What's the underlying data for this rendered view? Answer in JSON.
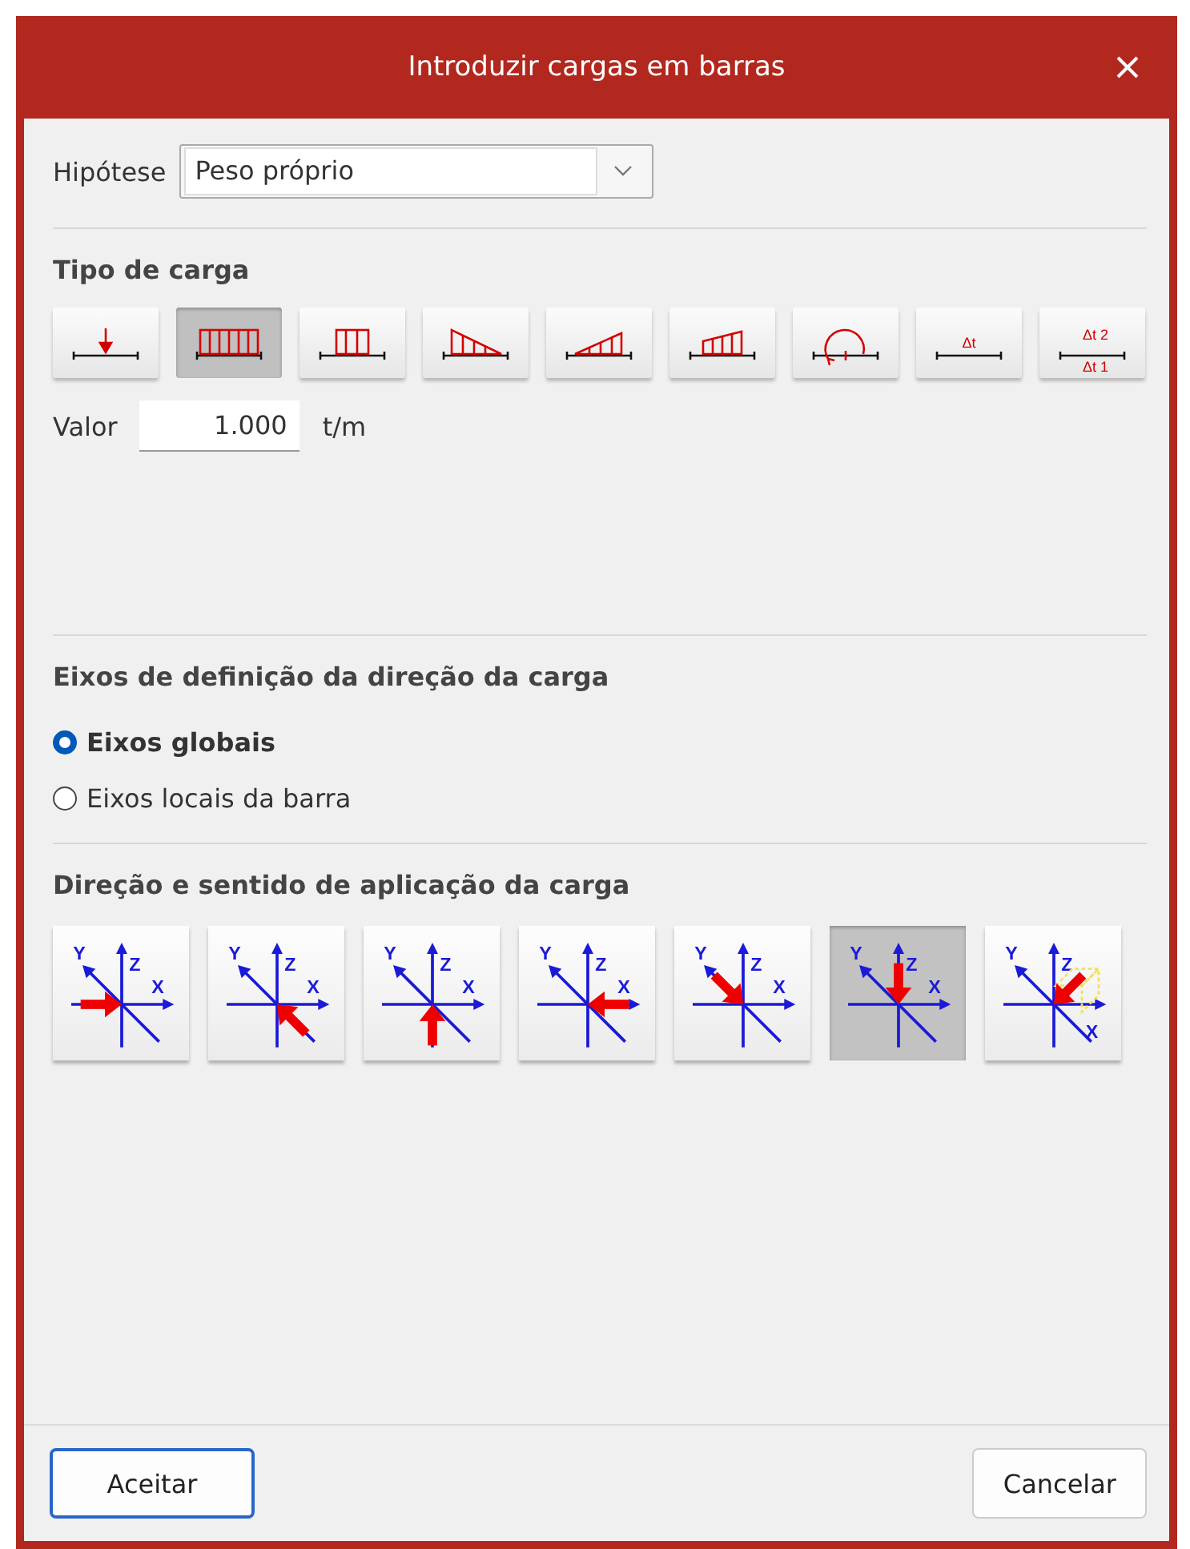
{
  "window": {
    "title": "Introduzir cargas em barras"
  },
  "hypothesis": {
    "label": "Hipótese",
    "value": "Peso próprio"
  },
  "load_type": {
    "heading": "Tipo de carga",
    "buttons": [
      {
        "kind": "point",
        "selected": false
      },
      {
        "kind": "uniform",
        "selected": true
      },
      {
        "kind": "partial",
        "selected": false
      },
      {
        "kind": "triangle-down",
        "selected": false
      },
      {
        "kind": "triangle-up",
        "selected": false
      },
      {
        "kind": "trapezoid",
        "selected": false
      },
      {
        "kind": "moment",
        "selected": false
      },
      {
        "kind": "temperature",
        "selected": false,
        "labels": [
          "Δt"
        ]
      },
      {
        "kind": "gradient",
        "selected": false,
        "labels": [
          "Δt 2",
          "Δt 1"
        ]
      }
    ],
    "value": {
      "label": "Valor",
      "value": "1.000",
      "unit": "t/m"
    }
  },
  "axes": {
    "heading": "Eixos de definição da direção da carga",
    "options": [
      {
        "label": "Eixos globais",
        "selected": true
      },
      {
        "label": "Eixos locais da barra",
        "selected": false
      }
    ]
  },
  "direction": {
    "heading": "Direção e sentido de aplicação da carga",
    "buttons": [
      {
        "kind": "xpos",
        "selected": false,
        "labels": [
          "Y",
          "Z",
          "X"
        ]
      },
      {
        "kind": "ypos",
        "selected": false,
        "labels": [
          "Y",
          "Z",
          "X"
        ]
      },
      {
        "kind": "zpos",
        "selected": false,
        "labels": [
          "Y",
          "Z",
          "X"
        ]
      },
      {
        "kind": "xneg",
        "selected": false,
        "labels": [
          "Y",
          "Z",
          "X"
        ]
      },
      {
        "kind": "yneg",
        "selected": false,
        "labels": [
          "Y",
          "Z",
          "X"
        ]
      },
      {
        "kind": "zneg",
        "selected": true,
        "labels": [
          "Y",
          "Z",
          "X"
        ]
      },
      {
        "kind": "arbitrary",
        "selected": false,
        "labels": [
          "Y",
          "Z",
          "X"
        ]
      }
    ]
  },
  "buttons": [
    {
      "label": "Aceitar",
      "default": true
    },
    {
      "label": "Cancelar",
      "default": false
    }
  ]
}
